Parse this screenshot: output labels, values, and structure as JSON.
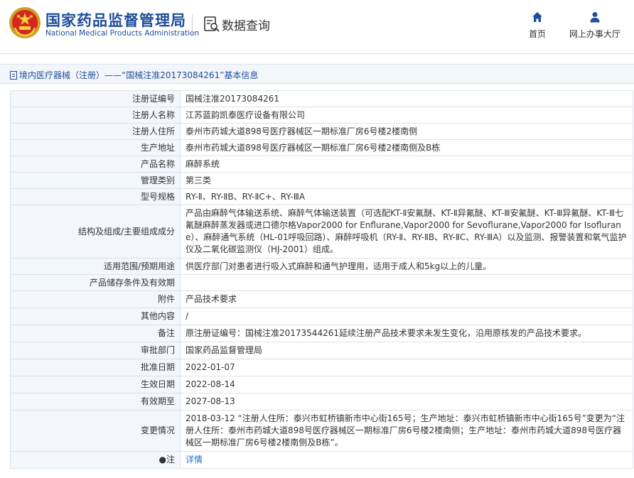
{
  "header": {
    "brand_cn": "国家药品监督管理局",
    "brand_en": "National Medical Products Administration",
    "query_title": "数据查询",
    "nav_home": "首页",
    "nav_service": "网上办事大厅",
    "brand_color": "#1f4e9b"
  },
  "breadcrumb": "境内医疗器械（注册）——“国械注准20173084261”基本信息",
  "rows": [
    {
      "label": "注册证编号",
      "value": "国械注准20173084261"
    },
    {
      "label": "注册人名称",
      "value": "江苏蓝韵凯泰医疗设备有限公司"
    },
    {
      "label": "注册人住所",
      "value": "泰州市药城大道898号医疗器械区一期标准厂房6号楼2楼南侧"
    },
    {
      "label": "生产地址",
      "value": "泰州市药城大道898号医疗器械区一期标准厂房6号楼2楼南侧及B栋"
    },
    {
      "label": "产品名称",
      "value": "麻醉系统"
    },
    {
      "label": "管理类别",
      "value": "第三类"
    },
    {
      "label": "型号规格",
      "value": "RY-Ⅱ、RY-ⅡB、RY-ⅡC+、RY-ⅢA"
    },
    {
      "label": "结构及组成/主要组成成分",
      "value": "产品由麻醉气体输送系统、麻醉气体输送装置（可选配KT-Ⅱ安氟醚、KT-Ⅱ异氟醚、KT-Ⅲ安氟醚、KT-Ⅲ异氟醚、KT-Ⅲ七氟醚麻醉蒸发器或进口德尔格Vapor2000 for Enflurane,Vapor2000 for Sevoflurane,Vapor2000 for Isoflurane）、麻醉通气系统（HL-01呼吸回路）、麻醉呼吸机（RY-Ⅱ、RY-ⅡB、RY-ⅡC、RY-ⅢA）以及监测、报警装置和氧气监护仪及二氧化碳监测仪（HJ-2001）组成。"
    },
    {
      "label": "适用范围/预期用途",
      "value": "供医疗部门对患者进行吸入式麻醉和通气护理用，适用于成人和5kg以上的儿童。"
    },
    {
      "label": "产品储存条件及有效期",
      "value": ""
    },
    {
      "label": "附件",
      "value": "产品技术要求"
    },
    {
      "label": "其他内容",
      "value": "/"
    },
    {
      "label": "备注",
      "value": "原注册证编号：国械注准20173544261延续注册产品技术要求未发生变化，沿用原核发的产品技术要求。"
    },
    {
      "label": "审批部门",
      "value": "国家药品监督管理局"
    },
    {
      "label": "批准日期",
      "value": "2022-01-07"
    },
    {
      "label": "生效日期",
      "value": "2022-08-14"
    },
    {
      "label": "有效期至",
      "value": "2027-08-13"
    },
    {
      "label": "变更情况",
      "value": "2018-03-12 “注册人住所：泰兴市虹桥镇新市中心街165号；生产地址：泰兴市虹桥镇新市中心街165号”变更为“注册人住所：泰州市药城大道898号医疗器械区一期标准厂房6号楼2楼南侧；生产地址：泰州市药城大道898号医疗器械区一期标准厂房6号楼2楼南侧及B栋”。"
    },
    {
      "label": "●注",
      "value": "详情"
    }
  ]
}
